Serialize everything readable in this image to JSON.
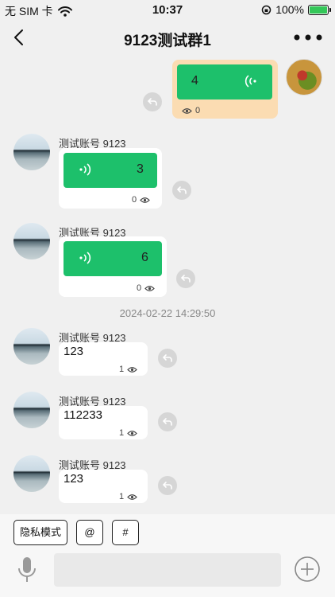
{
  "status_bar": {
    "carrier": "无 SIM 卡",
    "time": "10:37",
    "battery": "100%"
  },
  "nav": {
    "title": "9123测试群1"
  },
  "messages": [
    {
      "kind": "voice",
      "mine": true,
      "value": "4",
      "read_count": "0"
    },
    {
      "kind": "voice",
      "mine": false,
      "sender": "测试账号 9123",
      "value": "3",
      "read_count": "0"
    },
    {
      "kind": "voice",
      "mine": false,
      "sender": "测试账号 9123",
      "value": "6",
      "read_count": "0"
    },
    {
      "kind": "text",
      "mine": false,
      "sender": "测试账号 9123",
      "text": "123",
      "read_count": "1"
    },
    {
      "kind": "text",
      "mine": false,
      "sender": "测试账号 9123",
      "text": "112233",
      "read_count": "1"
    },
    {
      "kind": "text",
      "mine": false,
      "sender": "测试账号 9123",
      "text": "123",
      "read_count": "1"
    }
  ],
  "timestamp": "2024-02-22 14:29:50",
  "toolbar": {
    "private_mode": "隐私模式",
    "mention": "@",
    "topic": "#"
  },
  "input": {
    "placeholder": ""
  },
  "colors": {
    "voice_green": "#1dc06b",
    "mine_bubble": "#fbdcb2",
    "background": "#f0f0f0"
  }
}
